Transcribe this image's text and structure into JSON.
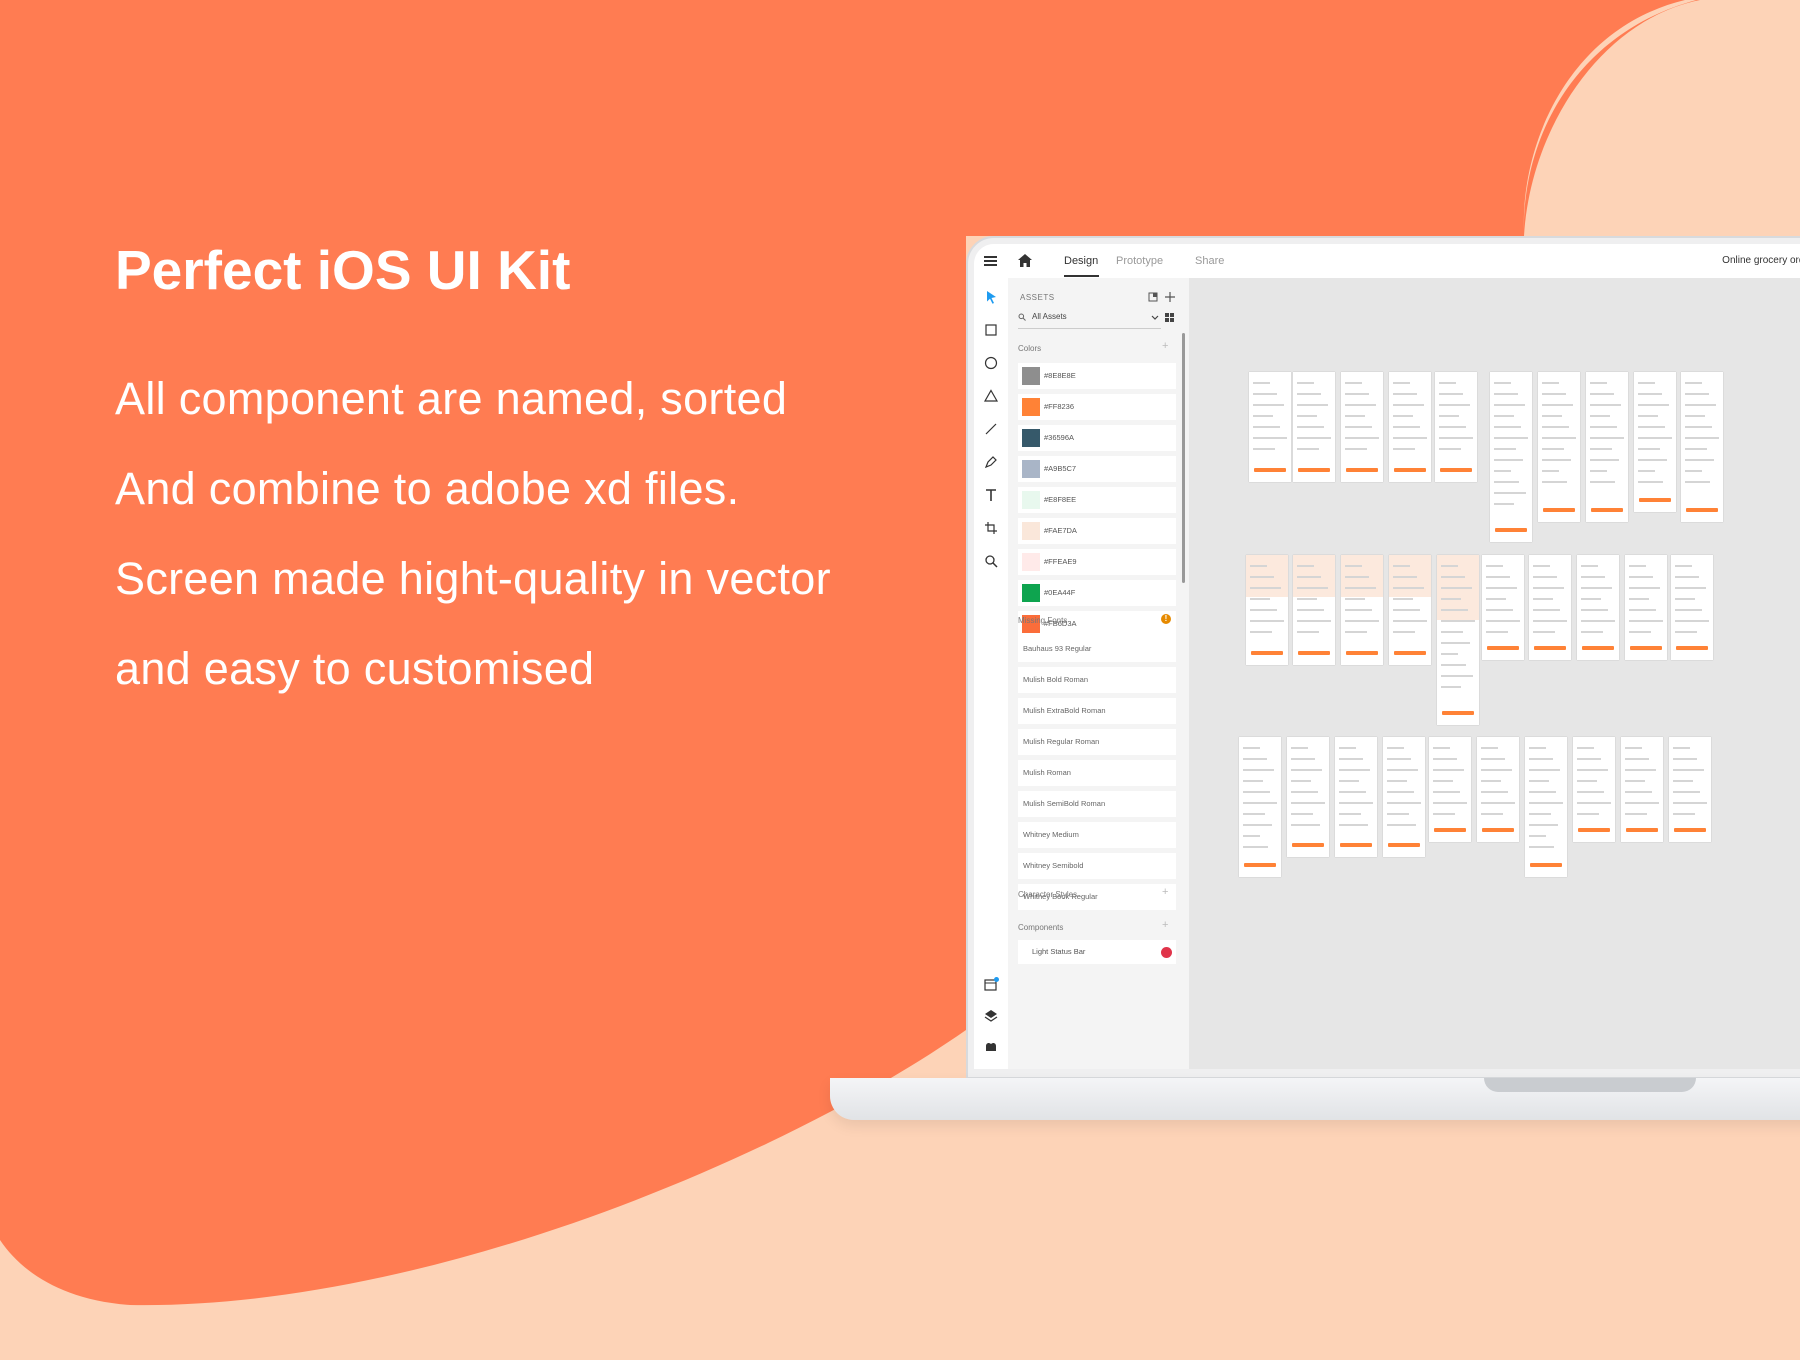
{
  "hero": {
    "title": "Perfect iOS UI Kit",
    "lines": [
      "All component are named,  sorted",
      "And combine to adobe xd files.",
      "Screen made hight-quality in vector",
      "and easy to customised"
    ]
  },
  "app": {
    "tabs": [
      {
        "label": "Design",
        "active": true
      },
      {
        "label": "Prototype",
        "active": false
      },
      {
        "label": "Share",
        "active": false
      }
    ],
    "document_title": "Online grocery order *",
    "tools": [
      "select-icon",
      "rectangle-icon",
      "ellipse-icon",
      "polygon-icon",
      "line-icon",
      "pen-icon",
      "text-icon",
      "artboard-icon",
      "zoom-icon"
    ],
    "bottom_tools": [
      "assets-icon",
      "layers-icon",
      "plugins-icon"
    ],
    "assets": {
      "header": "ASSETS",
      "filter": "All Assets",
      "colors_label": "Colors",
      "colors": [
        {
          "name": "#8E8E8E",
          "hex": "#8E8E8E"
        },
        {
          "name": "#FF8236",
          "hex": "#FF8236"
        },
        {
          "name": "#36596A",
          "hex": "#36596A"
        },
        {
          "name": "#A9B5C7",
          "hex": "#A9B5C7"
        },
        {
          "name": "#E8F8EE",
          "hex": "#E8F8EE"
        },
        {
          "name": "#FAE7DA",
          "hex": "#FAE7DA"
        },
        {
          "name": "#FFEAE9",
          "hex": "#FFEAE9"
        },
        {
          "name": "#0EA44F",
          "hex": "#0EA44F"
        },
        {
          "name": "#FB6D3A",
          "hex": "#FB6D3A"
        }
      ],
      "missing_fonts_label": "Missing Fonts",
      "missing_fonts": [
        "Bauhaus 93 Regular",
        "Mulish Bold Roman",
        "Mulish ExtraBold Roman",
        "Mulish Regular Roman",
        "Mulish Roman",
        "Mulish SemiBold Roman",
        "Whitney Medium",
        "Whitney Semibold",
        "Whitney Book Regular"
      ],
      "character_styles_label": "Character Styles",
      "components_label": "Components",
      "component_item": "Light Status Bar"
    }
  },
  "colors": {
    "accent": "#FF7C52",
    "background": "#FDD3B7",
    "xd_orange": "#FF8236",
    "xd_blue": "#1E9BF0"
  }
}
